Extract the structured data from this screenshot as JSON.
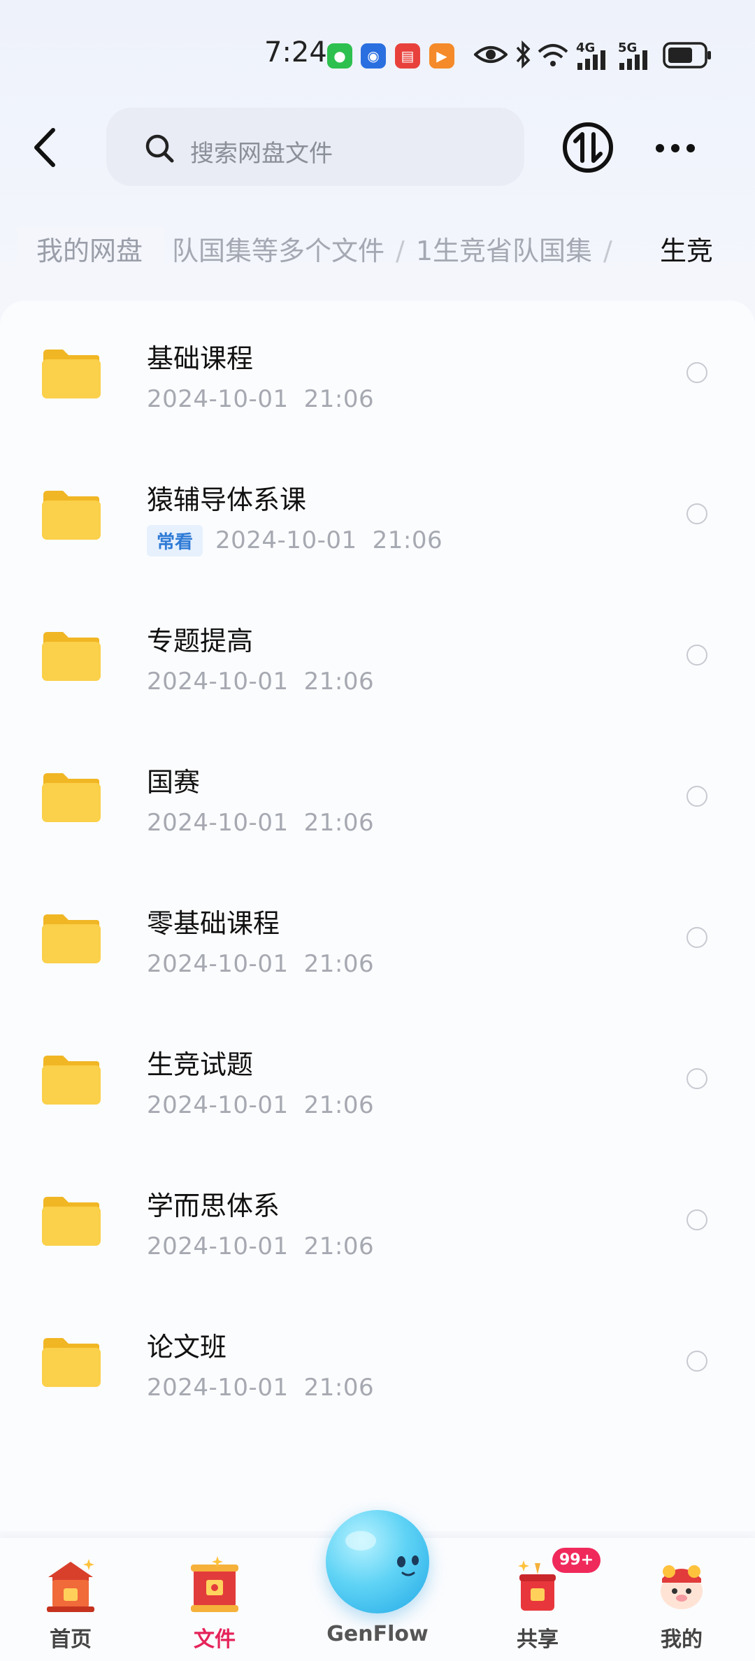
{
  "status_bar": {
    "time": "7:24",
    "network_1": "4G",
    "network_2": "5G"
  },
  "header": {
    "search_placeholder": "搜索网盘文件"
  },
  "breadcrumb": {
    "root": "我的网盘",
    "trail": [
      "队国集等多个文件",
      "1生竞省队国集"
    ],
    "separator": "/",
    "current": "生竞"
  },
  "files": [
    {
      "name": "基础课程",
      "date": "2024-10-01",
      "time": "21:06",
      "tag": ""
    },
    {
      "name": "猿辅导体系课",
      "date": "2024-10-01",
      "time": "21:06",
      "tag": "常看"
    },
    {
      "name": "专题提高",
      "date": "2024-10-01",
      "time": "21:06",
      "tag": ""
    },
    {
      "name": "国赛",
      "date": "2024-10-01",
      "time": "21:06",
      "tag": ""
    },
    {
      "name": "零基础课程",
      "date": "2024-10-01",
      "time": "21:06",
      "tag": ""
    },
    {
      "name": "生竞试题",
      "date": "2024-10-01",
      "time": "21:06",
      "tag": ""
    },
    {
      "name": "学而思体系",
      "date": "2024-10-01",
      "time": "21:06",
      "tag": ""
    },
    {
      "name": "论文班",
      "date": "2024-10-01",
      "time": "21:06",
      "tag": ""
    }
  ],
  "bottom_nav": {
    "home": "首页",
    "files": "文件",
    "genflow": "GenFlow",
    "share": "共享",
    "share_badge": "99+",
    "mine": "我的"
  },
  "colors": {
    "accent": "#e5245a",
    "folder": "#f9c93a",
    "tag_bg": "#e7f1fd",
    "tag_text": "#2f7bd6"
  }
}
